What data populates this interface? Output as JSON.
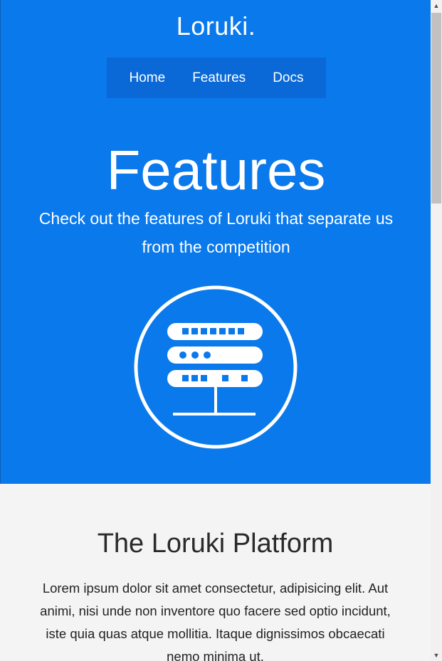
{
  "header": {
    "logo": "Loruki.",
    "nav": [
      {
        "label": "Home"
      },
      {
        "label": "Features"
      },
      {
        "label": "Docs"
      }
    ]
  },
  "hero": {
    "title": "Features",
    "subtitle": "Check out the features of Loruki that separate us from the competition",
    "icon": "server-icon",
    "background_color": "#0a79ec",
    "nav_background_color": "#0a69d6"
  },
  "platform": {
    "title": "The Loruki Platform",
    "body": "Lorem ipsum dolor sit amet consectetur, adipisicing elit. Aut animi, nisi unde non inventore quo facere sed optio incidunt, iste quia quas atque mollitia. Itaque dignissimos obcaecati nemo minima ut."
  },
  "scrollbar": {
    "up_icon": "scroll-up-arrow-icon",
    "down_icon": "scroll-down-arrow-icon"
  }
}
